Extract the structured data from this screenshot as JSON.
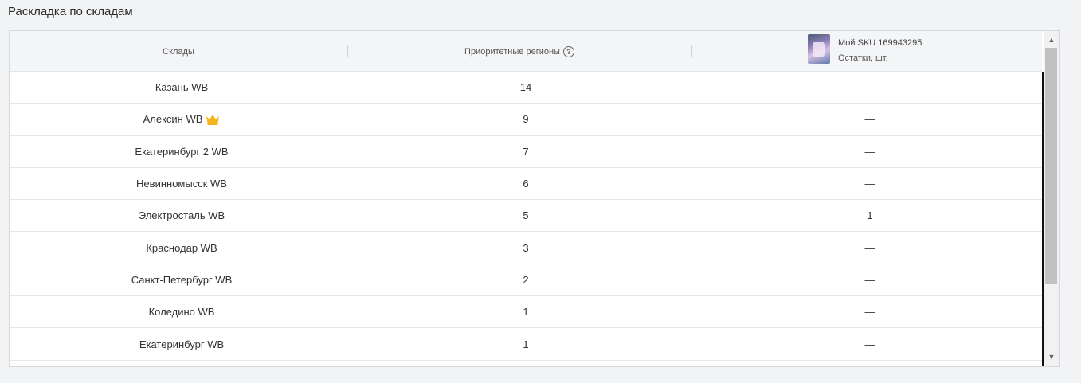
{
  "section": {
    "title": "Раскладка по складам"
  },
  "header": {
    "warehouses": "Склады",
    "regions": "Приоритетные регионы",
    "help_icon": "?",
    "sku_title": "Мой SKU 169943295",
    "sku_sub": "Остатки, шт."
  },
  "rows": [
    {
      "warehouse": "Казань WB",
      "regions": "14",
      "stock": "—"
    },
    {
      "warehouse": "Алексин WB",
      "regions": "9",
      "stock": "—",
      "badge": "crown-icon"
    },
    {
      "warehouse": "Екатеринбург 2 WB",
      "regions": "7",
      "stock": "—"
    },
    {
      "warehouse": "Невинномысск WB",
      "regions": "6",
      "stock": "—"
    },
    {
      "warehouse": "Электросталь WB",
      "regions": "5",
      "stock": "1"
    },
    {
      "warehouse": "Краснодар WB",
      "regions": "3",
      "stock": "—"
    },
    {
      "warehouse": "Санкт-Петербург WB",
      "regions": "2",
      "stock": "—"
    },
    {
      "warehouse": "Коледино WB",
      "regions": "1",
      "stock": "—"
    },
    {
      "warehouse": "Екатеринбург WB",
      "regions": "1",
      "stock": "—"
    }
  ],
  "scrollbar": {
    "up": "▲",
    "down": "▼"
  },
  "colors": {
    "crown": "#f3b41c",
    "header_bg": "#f4f5f7"
  }
}
